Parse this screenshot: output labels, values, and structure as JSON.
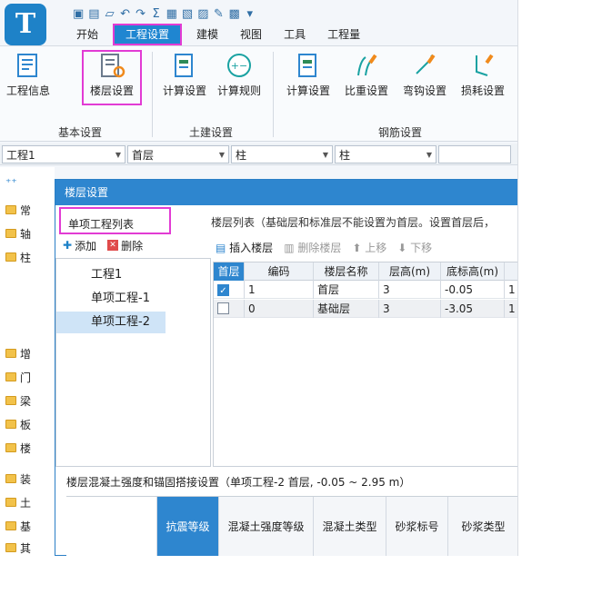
{
  "colors": {
    "accent": "#2e86cf",
    "highlight": "#e23bd4",
    "logo": "#1e82c8"
  },
  "app": {
    "logo_letter": "T"
  },
  "quick_access": [
    "save-icon",
    "print-icon",
    "open-icon",
    "undo-icon",
    "redo-icon",
    "sum-icon",
    "report-icon",
    "view-icon",
    "screenshot-icon",
    "pen-icon",
    "grid-icon",
    "customize-icon"
  ],
  "menu": {
    "items": [
      "开始",
      "工程设置",
      "建模",
      "视图",
      "工具",
      "工程量"
    ],
    "active": "工程设置"
  },
  "ribbon": {
    "buttons": [
      "工程信息",
      "楼层设置",
      "计算设置",
      "计算规则",
      "计算设置",
      "比重设置",
      "弯钩设置",
      "损耗设置"
    ],
    "groups": [
      "基本设置",
      "土建设置",
      "钢筋设置"
    ]
  },
  "combos": [
    "工程1",
    "首层",
    "柱",
    "柱"
  ],
  "tree": {
    "items": [
      "常",
      "轴",
      "柱",
      "增",
      "门",
      "梁",
      "板",
      "楼",
      "装",
      "土",
      "基",
      "其"
    ]
  },
  "dialog": {
    "title": "楼层设置",
    "project_list_title": "单项工程列表",
    "add_label": "添加",
    "delete_label": "删除",
    "projects": [
      "工程1",
      "单项工程-1",
      "单项工程-2"
    ],
    "selected_project": "单项工程-2",
    "floor_list_label": "楼层列表（基础层和标准层不能设置为首层。设置首层后，",
    "floor_toolbar": {
      "insert": "插入楼层",
      "delete": "删除楼层",
      "up": "上移",
      "down": "下移"
    },
    "floor_table": {
      "headers": [
        "首层",
        "编码",
        "楼层名称",
        "层高(m)",
        "底标高(m)",
        ""
      ],
      "rows": [
        {
          "checked": true,
          "code": "1",
          "name": "首层",
          "height": "3",
          "bottom": "-0.05",
          "extra": "1"
        },
        {
          "checked": false,
          "code": "0",
          "name": "基础层",
          "height": "3",
          "bottom": "-3.05",
          "extra": "1"
        }
      ]
    },
    "section_label": "楼层混凝土强度和锚固搭接设置（单项工程-2 首层, -0.05 ~ 2.95 m）",
    "grid2_headers": [
      "",
      "抗震等级",
      "混凝土强度等级",
      "混凝土类型",
      "砂浆标号",
      "砂浆类型"
    ]
  }
}
